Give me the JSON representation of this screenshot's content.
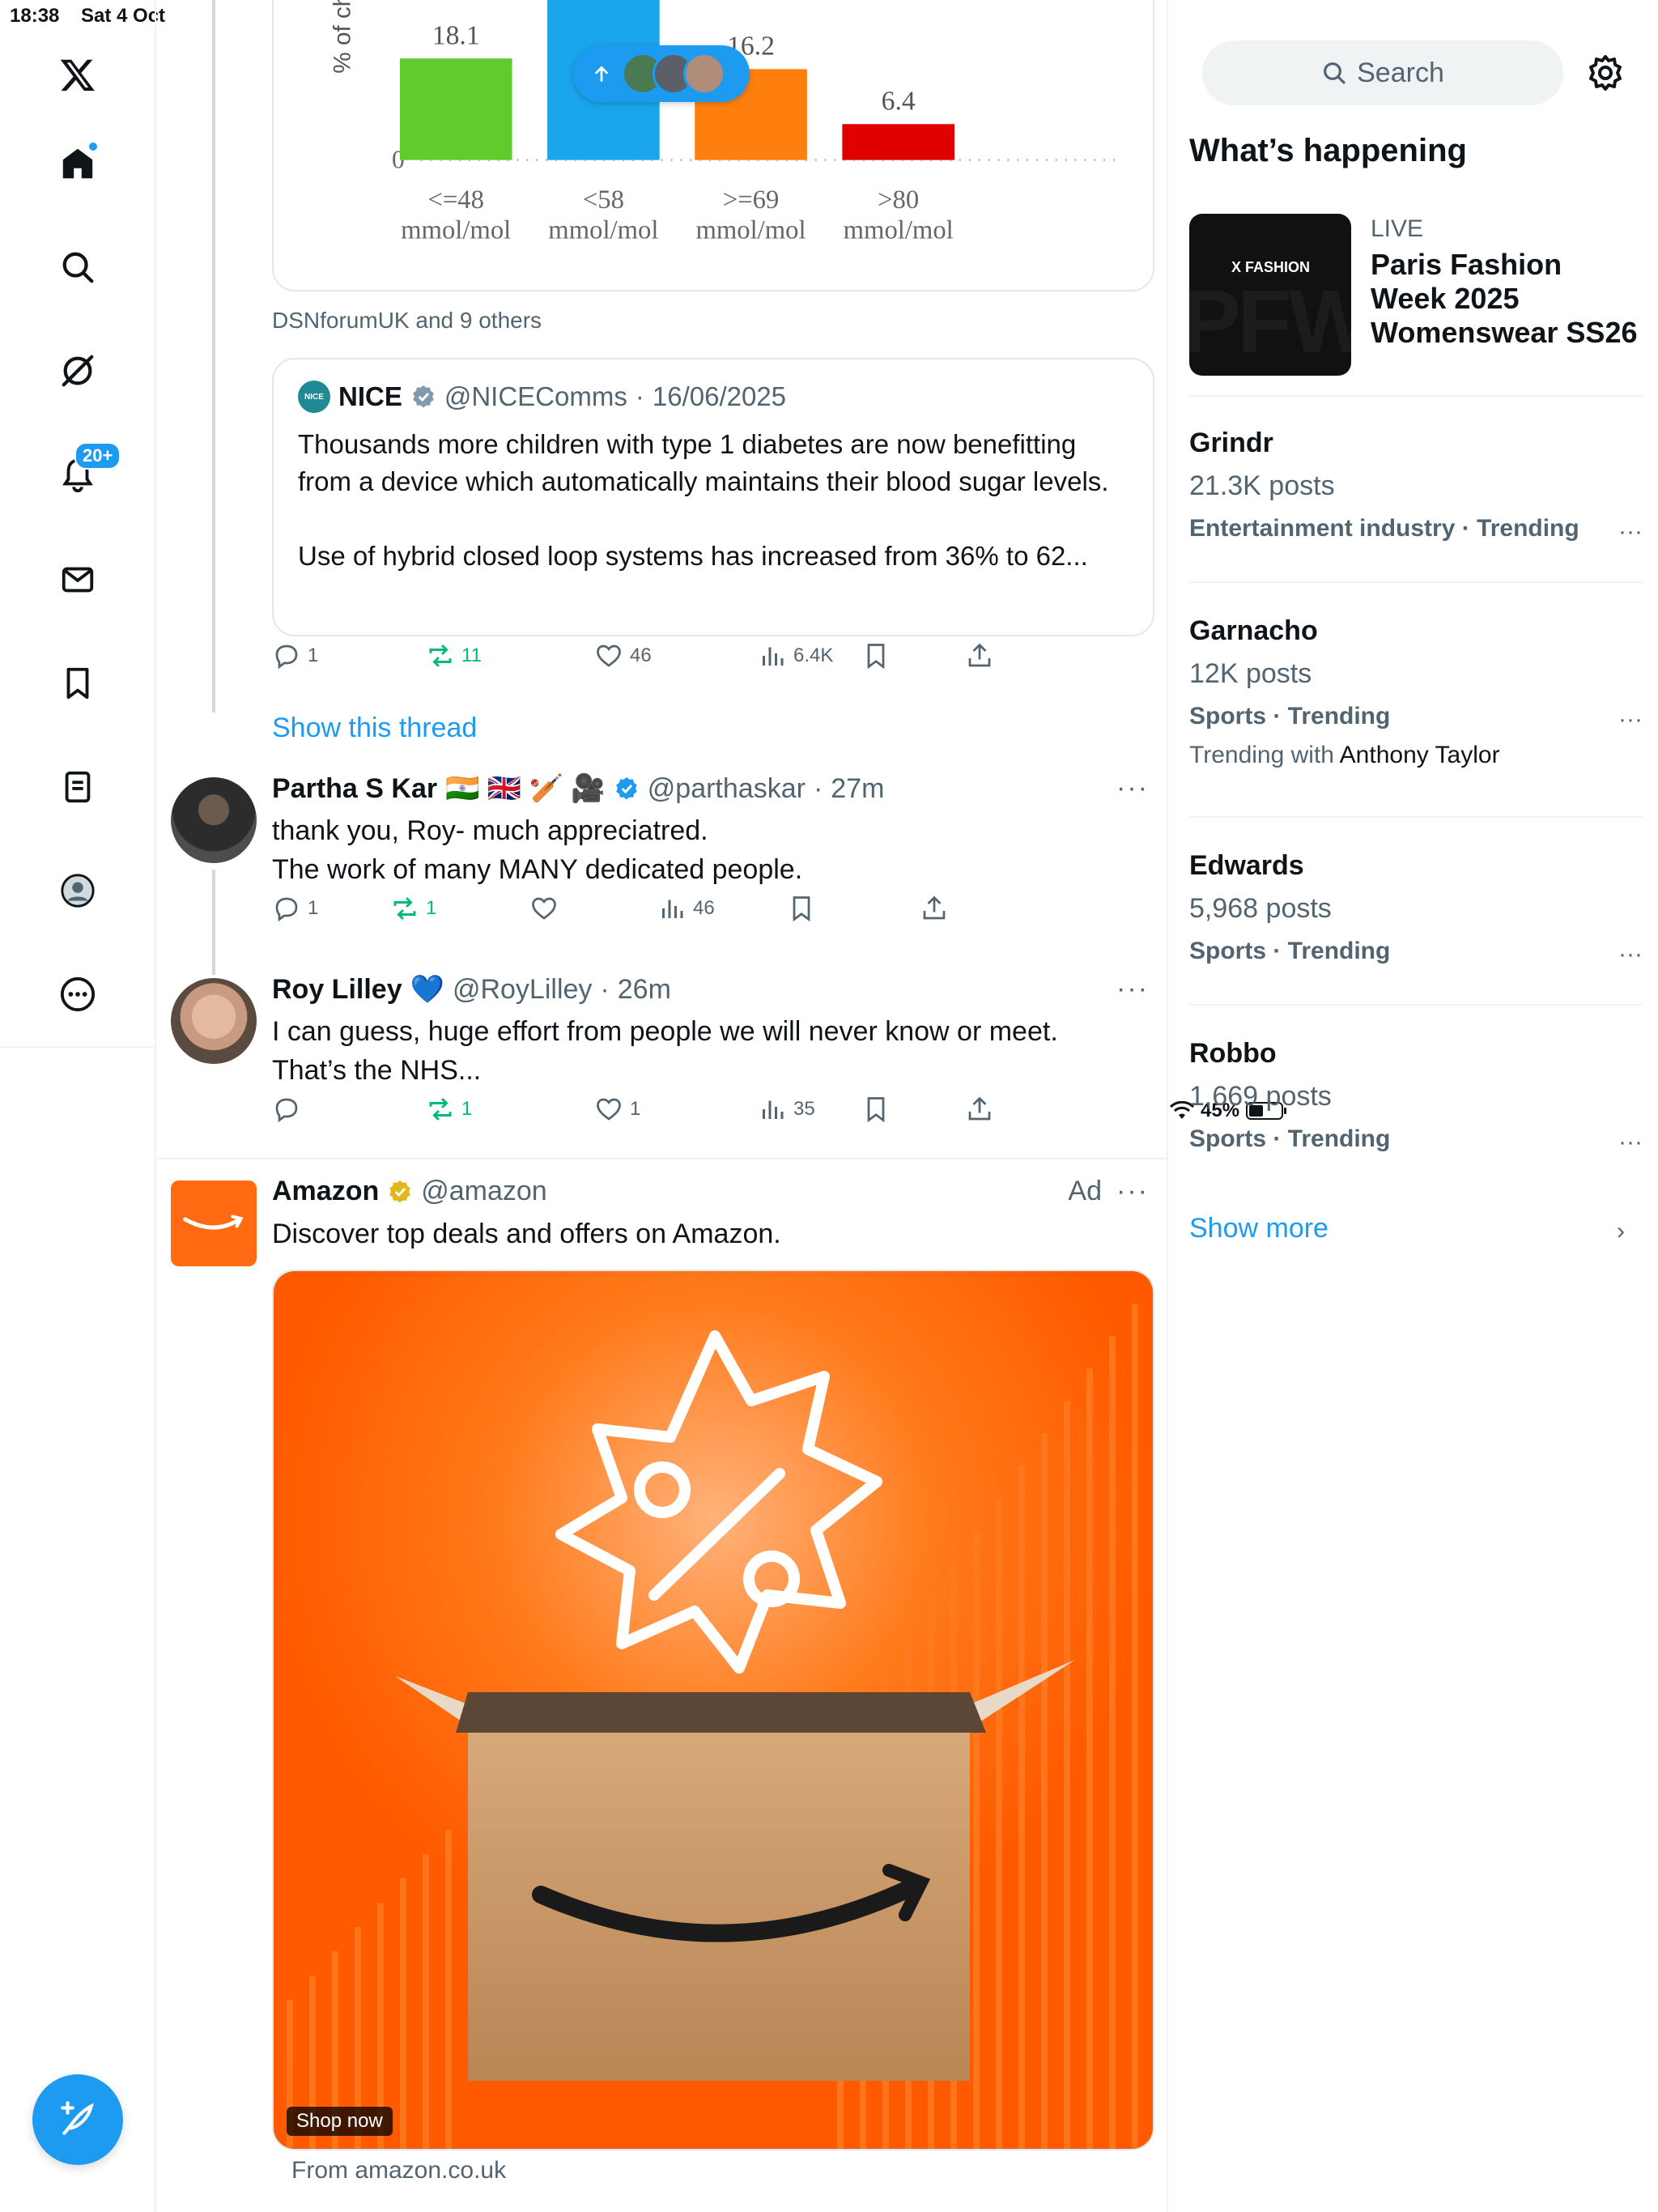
{
  "status_bar": {
    "time": "18:38",
    "date": "Sat 4 Oct",
    "battery_text": "45%",
    "battery_level": 0.45
  },
  "nav": {
    "items": [
      "x-logo",
      "home",
      "explore",
      "grok",
      "notifications",
      "messages",
      "bookmarks",
      "lists",
      "profile",
      "more"
    ],
    "notifications_badge": "20+"
  },
  "chart_data": {
    "type": "bar",
    "categories": [
      "<=48 mmol/mol",
      "<58 mmol/mol",
      ">=69 mmol/mol",
      ">80 mmol/mol"
    ],
    "category_lines": [
      [
        "<=48",
        "mmol/mol"
      ],
      [
        "<58",
        "mmol/mol"
      ],
      [
        ">=69",
        "mmol/mol"
      ],
      [
        ">80",
        "mmol/mol"
      ]
    ],
    "values": [
      18.1,
      30.0,
      16.2,
      6.4
    ],
    "value_labels": [
      "18.1",
      "",
      "16.2",
      "6.4"
    ],
    "colors": [
      "#5fcb2c",
      "#19a6ea",
      "#ff7f0e",
      "#e00000"
    ],
    "ylabel": "% of childre",
    "zero_label": "0",
    "ylim": [
      0,
      32
    ]
  },
  "feed": {
    "liked_by": "DSNforumUK and 9 others",
    "quote": {
      "name": "NICE",
      "logo_text": "NICE",
      "handle": "@NICEComms",
      "date": "16/06/2025",
      "line1": "Thousands more children with type 1 diabetes are now benefitting from a device which automatically maintains their blood sugar levels.",
      "line2": "Use of hybrid closed loop systems has increased from 36% to 62..."
    },
    "main_actions": {
      "replies": "1",
      "reposts": "11",
      "likes": "46",
      "views": "6.4K"
    },
    "show_thread": "Show this thread",
    "tweets": [
      {
        "name": "Partha S Kar",
        "emojis": "🇮🇳 🇬🇧 🏏 🎥",
        "handle": "@parthaskar",
        "time": "27m",
        "text1": "thank you, Roy- much appreciatred.",
        "text2": "The work of many MANY dedicated people.",
        "replies": "1",
        "reposts": "1",
        "likes": "",
        "views": "46"
      },
      {
        "name": "Roy Lilley",
        "emojis": "💙",
        "handle": "@RoyLilley",
        "time": "26m",
        "text1": "I can guess, huge effort from people we will never know or meet.",
        "text2": "That’s the NHS...",
        "replies": "",
        "reposts": "1",
        "likes": "1",
        "views": "35"
      }
    ],
    "ad": {
      "name": "Amazon",
      "handle": "@amazon",
      "ad_label": "Ad",
      "text": "Discover top deals and offers on Amazon.",
      "cta": "Shop now",
      "source": "From amazon.co.uk"
    }
  },
  "sidebar": {
    "search_placeholder": "Search",
    "title": "What’s happening",
    "live": {
      "label": "LIVE",
      "title": "Paris Fashion Week 2025 Womenswear SS26",
      "thumb_label": "X FASHION",
      "thumb_bg_text": "PFW"
    },
    "trends": [
      {
        "name": "Grindr",
        "posts": "21.3K posts",
        "category": "Entertainment industry · Trending"
      },
      {
        "name": "Garnacho",
        "posts": "12K posts",
        "category": "Sports · Trending",
        "with_prefix": "Trending with",
        "with_name": "Anthony Taylor"
      },
      {
        "name": "Edwards",
        "posts": "5,968 posts",
        "category": "Sports · Trending"
      },
      {
        "name": "Robbo",
        "posts": "1,669 posts",
        "category": "Sports · Trending"
      }
    ],
    "show_more": "Show more",
    "colors": {
      "accent": "#1d9bf0",
      "repost_green": "#00ba7c",
      "amazon_orange": "#ff5a00"
    }
  }
}
